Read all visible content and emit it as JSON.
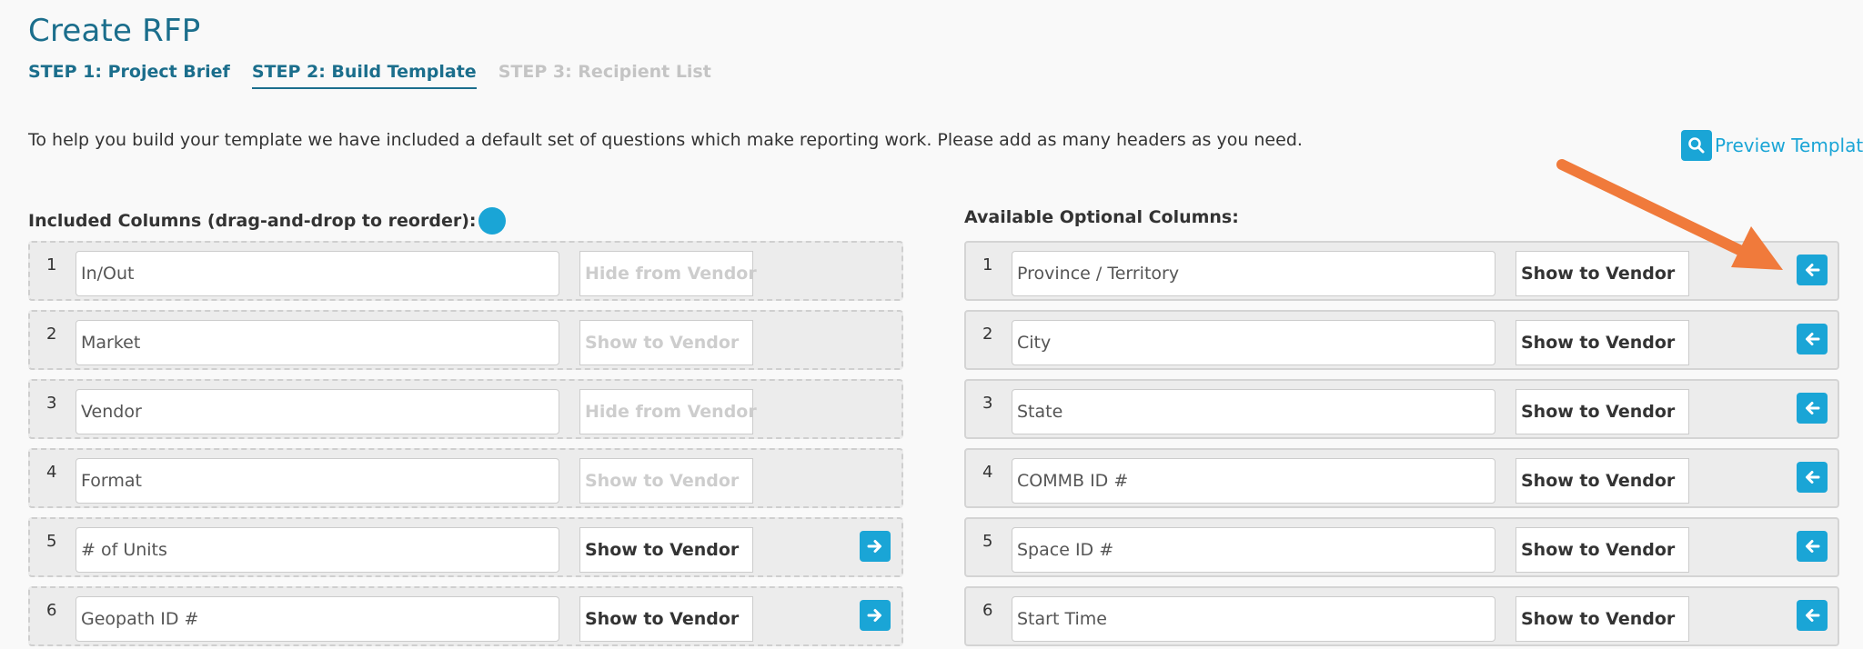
{
  "page": {
    "title": "Create RFP",
    "steps": [
      {
        "label": "STEP 1: Project Brief",
        "state": "complete"
      },
      {
        "label": "STEP 2: Build Template",
        "state": "active"
      },
      {
        "label": "STEP 3: Recipient List",
        "state": "disabled"
      }
    ],
    "intro": "To help you build your template we have included a default set of questions which make reporting work. Please add as many headers as you need.",
    "preview_label": "Preview Template"
  },
  "included": {
    "heading": "Included Columns (drag-and-drop to reorder):",
    "rows": [
      {
        "num": "1",
        "value": "In/Out",
        "visibility": "Hide from Vendor",
        "locked": true
      },
      {
        "num": "2",
        "value": "Market",
        "visibility": "Show to Vendor",
        "locked": true
      },
      {
        "num": "3",
        "value": "Vendor",
        "visibility": "Hide from Vendor",
        "locked": true
      },
      {
        "num": "4",
        "value": "Format",
        "visibility": "Show to Vendor",
        "locked": true
      },
      {
        "num": "5",
        "value": "# of Units",
        "visibility": "Show to Vendor",
        "locked": false
      },
      {
        "num": "6",
        "value": "Geopath ID #",
        "visibility": "Show to Vendor",
        "locked": false
      }
    ]
  },
  "available": {
    "heading": "Available Optional Columns:",
    "rows": [
      {
        "num": "1",
        "value": "Province / Territory",
        "visibility": "Show to Vendor"
      },
      {
        "num": "2",
        "value": "City",
        "visibility": "Show to Vendor"
      },
      {
        "num": "3",
        "value": "State",
        "visibility": "Show to Vendor"
      },
      {
        "num": "4",
        "value": "COMMB ID #",
        "visibility": "Show to Vendor"
      },
      {
        "num": "5",
        "value": "Space ID #",
        "visibility": "Show to Vendor"
      },
      {
        "num": "6",
        "value": "Start Time",
        "visibility": "Show to Vendor"
      }
    ]
  },
  "colors": {
    "brand": "#1b6e8c",
    "accent": "#1aa5d6",
    "annotation": "#f07a3b"
  },
  "icons": {
    "preview": "search-icon",
    "move_right": "arrow-right-icon",
    "move_left": "arrow-left-icon"
  }
}
